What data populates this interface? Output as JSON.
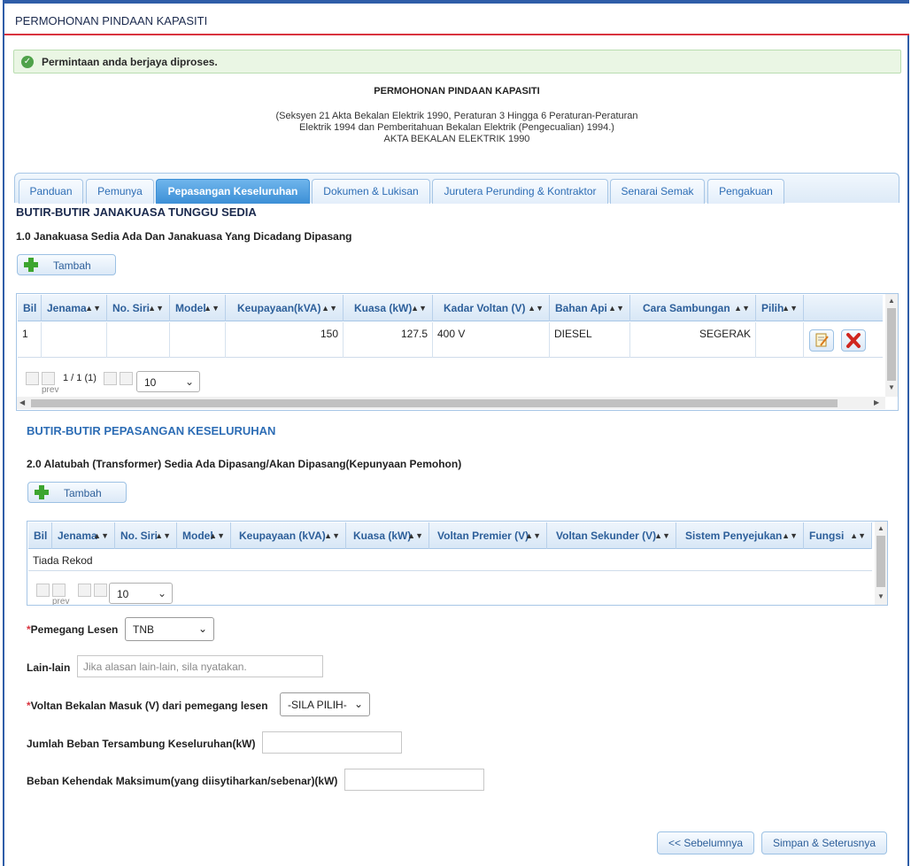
{
  "header": {
    "title": "PERMOHONAN PINDAAN KAPASITI"
  },
  "alert": {
    "message": "Permintaan anda berjaya diproses."
  },
  "form_title": {
    "main": "PERMOHONAN PINDAAN KAPASITI",
    "sub_line1": "(Seksyen 21 Akta Bekalan Elektrik 1990, Peraturan 3 Hingga 6 Peraturan-Peraturan",
    "sub_line2": "Elektrik 1994 dan Pemberitahuan Bekalan Elektrik (Pengecualian) 1994.)",
    "sub_line3": "AKTA BEKALAN ELEKTRIK 1990"
  },
  "tabs": [
    {
      "label": "Panduan",
      "active": false
    },
    {
      "label": "Pemunya",
      "active": false
    },
    {
      "label": "Pepasangan Keseluruhan",
      "active": true
    },
    {
      "label": "Dokumen & Lukisan",
      "active": false
    },
    {
      "label": "Jurutera Perunding & Kontraktor",
      "active": false
    },
    {
      "label": "Senarai Semak",
      "active": false
    },
    {
      "label": "Pengakuan",
      "active": false
    }
  ],
  "section1": {
    "heading": "BUTIR-BUTIR JANAKUASA TUNGGU SEDIA",
    "subheading": "1.0 Janakuasa Sedia Ada Dan Janakuasa Yang Dicadang Dipasang",
    "add_label": "Tambah",
    "columns": [
      "Bil",
      "Jenama",
      "No. Siri",
      "Model",
      "Keupayaan(kVA)",
      "Kuasa (kW)",
      "Kadar Voltan (V)",
      "Bahan Api",
      "Cara Sambungan",
      "Pilih"
    ],
    "rows": [
      {
        "bil": "1",
        "jenama": "",
        "no_siri": "",
        "model": "",
        "keupayaan": "150",
        "kuasa": "127.5",
        "voltan": "400 V",
        "bahan_api": "DIESEL",
        "cara": "SEGERAK"
      }
    ],
    "pager": {
      "prev_alt": "prev",
      "info": "1 / 1 (1)",
      "page_size": "10"
    }
  },
  "section2": {
    "heading": "BUTIR-BUTIR PEPASANGAN KESELURUHAN",
    "subheading": "2.0 Alatubah (Transformer) Sedia Ada Dipasang/Akan Dipasang(Kepunyaan Pemohon)",
    "add_label": "Tambah",
    "columns": [
      "Bil",
      "Jenama",
      "No. Siri",
      "Model",
      "Keupayaan (kVA)",
      "Kuasa (kW)",
      "Voltan Premier (V)",
      "Voltan Sekunder (V)",
      "Sistem Penyejukan",
      "Fungsi"
    ],
    "empty_text": "Tiada Rekod",
    "pager": {
      "prev_alt": "prev",
      "page_size": "10"
    }
  },
  "form": {
    "pemegang_lesen_label": "Pemegang Lesen",
    "pemegang_lesen_value": "TNB",
    "lain_label": "Lain-lain",
    "lain_placeholder": "Jika alasan lain-lain, sila nyatakan.",
    "voltan_label": "Voltan Bekalan Masuk (V) dari pemegang lesen",
    "voltan_value": "-SILA PILIH-",
    "jumlah_beban_label": "Jumlah Beban Tersambung Keseluruhan(kW)",
    "jumlah_beban_value": "",
    "beban_maks_label": "Beban Kehendak Maksimum(yang diisytiharkan/sebenar)(kW)",
    "beban_maks_value": ""
  },
  "nav": {
    "prev_label": "<< Sebelumnya",
    "next_label": "Simpan & Seterusnya"
  },
  "colors": {
    "accent": "#2f5da8",
    "header_rule": "#d9333f",
    "tab_active": "#3c8fd6",
    "link": "#2d6db5"
  }
}
